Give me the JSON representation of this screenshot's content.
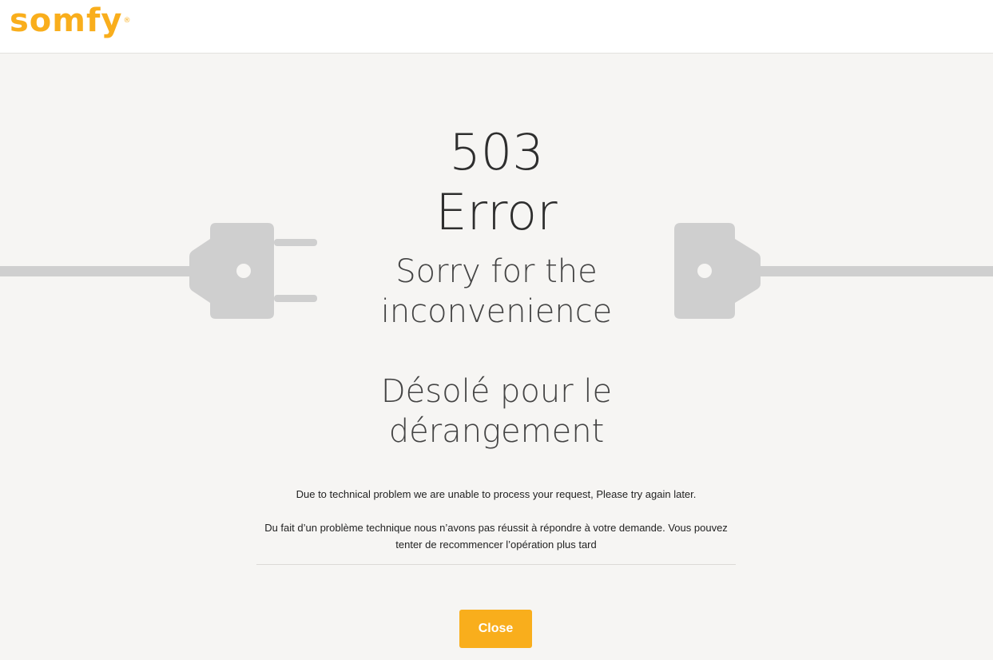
{
  "brand": {
    "logo_text": "somfy",
    "registered_mark": "®",
    "color": "#f9ae1c"
  },
  "error": {
    "code": "503",
    "word": "Error",
    "title_en": "Sorry for the inconvenience",
    "title_fr": "Désolé pour le dérangement",
    "message_en": "Due to technical problem we are unable to process your request, Please try again later.",
    "message_fr": "Du fait d’un problème technique nous n’avons pas réussit à répondre à votre demande. Vous pouvez tenter de recommencer l’opération plus tard"
  },
  "actions": {
    "close_label": "Close"
  },
  "illustration": {
    "icon_left": "plug-icon",
    "icon_right": "socket-icon",
    "color": "#cfcfcf"
  }
}
